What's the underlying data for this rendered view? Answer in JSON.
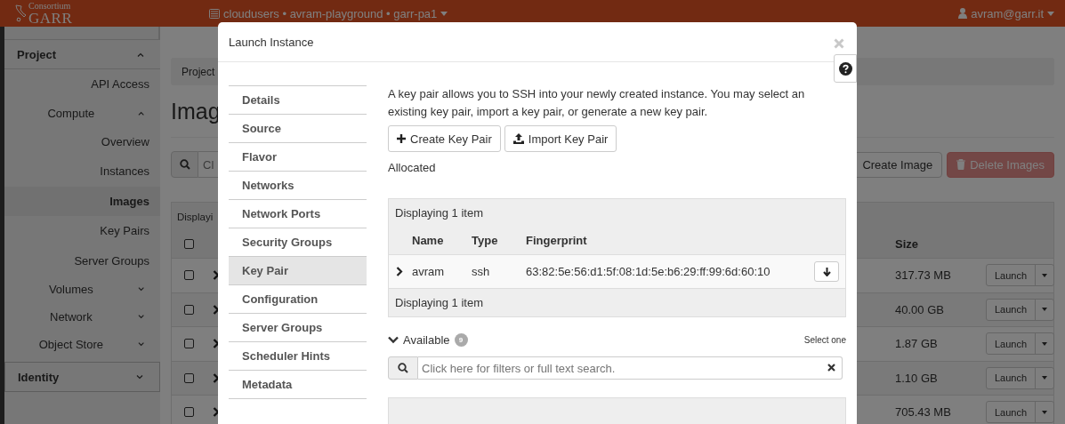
{
  "header": {
    "logo_top": "Consortium",
    "logo_main": "GARR",
    "project_selector": "cloudusers • avram-playground • garr-pa1",
    "user": "avram@garr.it"
  },
  "sidebar": {
    "items": [
      {
        "label": "Project",
        "kind": "section",
        "expanded": true,
        "children": [
          {
            "label": "API Access",
            "kind": "link",
            "selected": false
          },
          {
            "label": "Compute",
            "kind": "group",
            "expanded": true,
            "children": [
              {
                "label": "Overview",
                "kind": "link",
                "selected": false
              },
              {
                "label": "Instances",
                "kind": "link",
                "selected": false
              },
              {
                "label": "Images",
                "kind": "link",
                "selected": true
              },
              {
                "label": "Key Pairs",
                "kind": "link",
                "selected": false
              },
              {
                "label": "Server Groups",
                "kind": "link",
                "selected": false
              }
            ]
          },
          {
            "label": "Volumes",
            "kind": "group",
            "expanded": false
          },
          {
            "label": "Network",
            "kind": "group",
            "expanded": false
          },
          {
            "label": "Object Store",
            "kind": "group",
            "expanded": false
          }
        ]
      },
      {
        "label": "Identity",
        "kind": "section",
        "expanded": false
      }
    ]
  },
  "page": {
    "breadcrumb": "Project",
    "title": "Imag",
    "search_placeholder": "Cl",
    "buttons": [
      {
        "label": "Create Image",
        "kind": "default",
        "disabled": false
      },
      {
        "label": "Delete Images",
        "kind": "danger",
        "disabled": true
      }
    ],
    "table": {
      "caption": "Displayi",
      "select_all_checked": false,
      "columns": [
        "Size"
      ],
      "rows": [
        {
          "checked": false,
          "expanded": false,
          "size": "317.73 MB",
          "action": "Launch"
        },
        {
          "checked": false,
          "expanded": false,
          "size": "40.00 GB",
          "action": "Launch"
        },
        {
          "checked": false,
          "expanded": false,
          "size": "1.87 GB",
          "action": "Launch"
        },
        {
          "checked": false,
          "expanded": false,
          "size": "1.10 GB",
          "action": "Launch"
        },
        {
          "checked": false,
          "expanded": false,
          "size": "705.43 MB",
          "action": "Launch"
        }
      ]
    }
  },
  "modal": {
    "title": "Launch Instance",
    "steps": [
      {
        "label": "Details",
        "selected": false
      },
      {
        "label": "Source",
        "selected": false
      },
      {
        "label": "Flavor",
        "selected": false
      },
      {
        "label": "Networks",
        "selected": false
      },
      {
        "label": "Network Ports",
        "selected": false
      },
      {
        "label": "Security Groups",
        "selected": false
      },
      {
        "label": "Key Pair",
        "selected": true
      },
      {
        "label": "Configuration",
        "selected": false
      },
      {
        "label": "Server Groups",
        "selected": false
      },
      {
        "label": "Scheduler Hints",
        "selected": false
      },
      {
        "label": "Metadata",
        "selected": false
      }
    ],
    "description": "A key pair allows you to SSH into your newly created instance. You may select an existing key pair, import a key pair, or generate a new key pair.",
    "actions": [
      {
        "label": "Create Key Pair",
        "kind": "plus"
      },
      {
        "label": "Import Key Pair",
        "kind": "upload"
      }
    ],
    "allocated": {
      "label": "Allocated",
      "header_count": "Displaying 1 item",
      "columns": [
        "Name",
        "Type",
        "Fingerprint"
      ],
      "rows": [
        {
          "expanded": false,
          "name": "avram",
          "type": "ssh",
          "fingerprint": "63:82:5e:56:d1:5f:08:1d:5e:b6:29:ff:99:6d:60:10"
        }
      ],
      "footer_count": "Displaying 1 item"
    },
    "available": {
      "label": "Available",
      "count": "9",
      "expanded": true,
      "hint": "Select one",
      "search_placeholder": "Click here for filters or full text search."
    }
  }
}
